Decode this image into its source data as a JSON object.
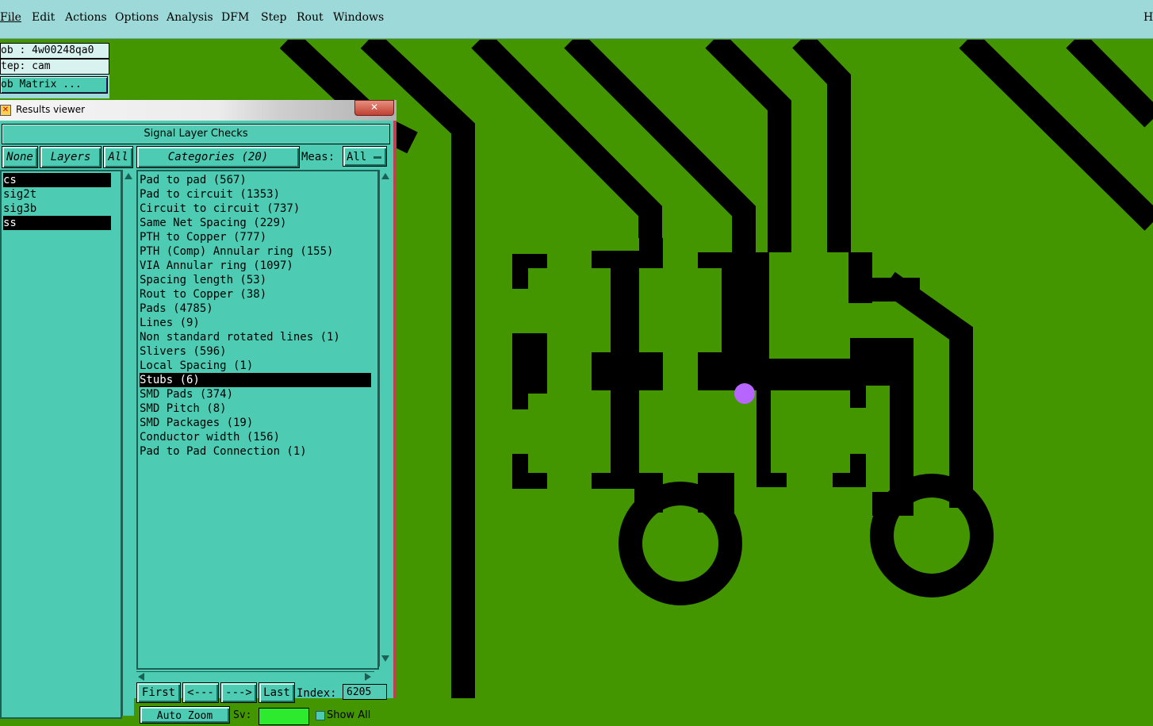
{
  "menubar": {
    "items": [
      "File",
      "Edit",
      "Actions",
      "Options",
      "Analysis",
      "DFM",
      "Step",
      "Rout",
      "Windows"
    ],
    "right_item": "H"
  },
  "job_panel": {
    "job_label": "ob : 4w00248qa0",
    "step_label": "tep: cam",
    "matrix_button": "ob Matrix ..."
  },
  "results_window": {
    "title": "Results viewer",
    "close_label": "✕",
    "header": "Signal Layer Checks",
    "layers": {
      "none_label": "None",
      "layers_label": "Layers",
      "all_label": "All",
      "items": [
        {
          "label": "cs",
          "selected": true
        },
        {
          "label": "sig2t",
          "selected": false
        },
        {
          "label": "sig3b",
          "selected": false
        },
        {
          "label": "ss",
          "selected": true
        }
      ]
    },
    "categories": {
      "header": "Categories (20)",
      "meas_label": "Meas:",
      "meas_value": "All",
      "items": [
        {
          "label": "Pad to pad (567)",
          "selected": false
        },
        {
          "label": "Pad to circuit (1353)",
          "selected": false
        },
        {
          "label": "Circuit to circuit (737)",
          "selected": false
        },
        {
          "label": "Same Net Spacing (229)",
          "selected": false
        },
        {
          "label": "PTH to Copper (777)",
          "selected": false
        },
        {
          "label": "PTH (Comp) Annular ring (155)",
          "selected": false
        },
        {
          "label": "VIA Annular ring (1097)",
          "selected": false
        },
        {
          "label": "Spacing length (53)",
          "selected": false
        },
        {
          "label": "Rout to Copper (38)",
          "selected": false
        },
        {
          "label": "Pads (4785)",
          "selected": false
        },
        {
          "label": "Lines (9)",
          "selected": false
        },
        {
          "label": "Non standard rotated lines (1)",
          "selected": false
        },
        {
          "label": "Slivers (596)",
          "selected": false
        },
        {
          "label": "Local Spacing (1)",
          "selected": false
        },
        {
          "label": "Stubs (6)",
          "selected": true
        },
        {
          "label": "SMD Pads (374)",
          "selected": false
        },
        {
          "label": "SMD Pitch (8)",
          "selected": false
        },
        {
          "label": "SMD Packages (19)",
          "selected": false
        },
        {
          "label": "Conductor width (156)",
          "selected": false
        },
        {
          "label": "Pad to Pad Connection (1)",
          "selected": false
        }
      ]
    },
    "nav": {
      "first": "First",
      "prev": "<---",
      "next": "--->",
      "last": "Last",
      "index_label": "Index:",
      "index_value": "6205"
    },
    "bottom": {
      "auto_zoom": "Auto Zoom",
      "sv_label": "Sv:",
      "show_all": "Show All"
    }
  },
  "colors": {
    "board_green": "#449600",
    "copper_black": "#000000",
    "marker": "#b666ff",
    "panel_teal": "#4ecbb3",
    "menubar": "#9dd9d8"
  }
}
